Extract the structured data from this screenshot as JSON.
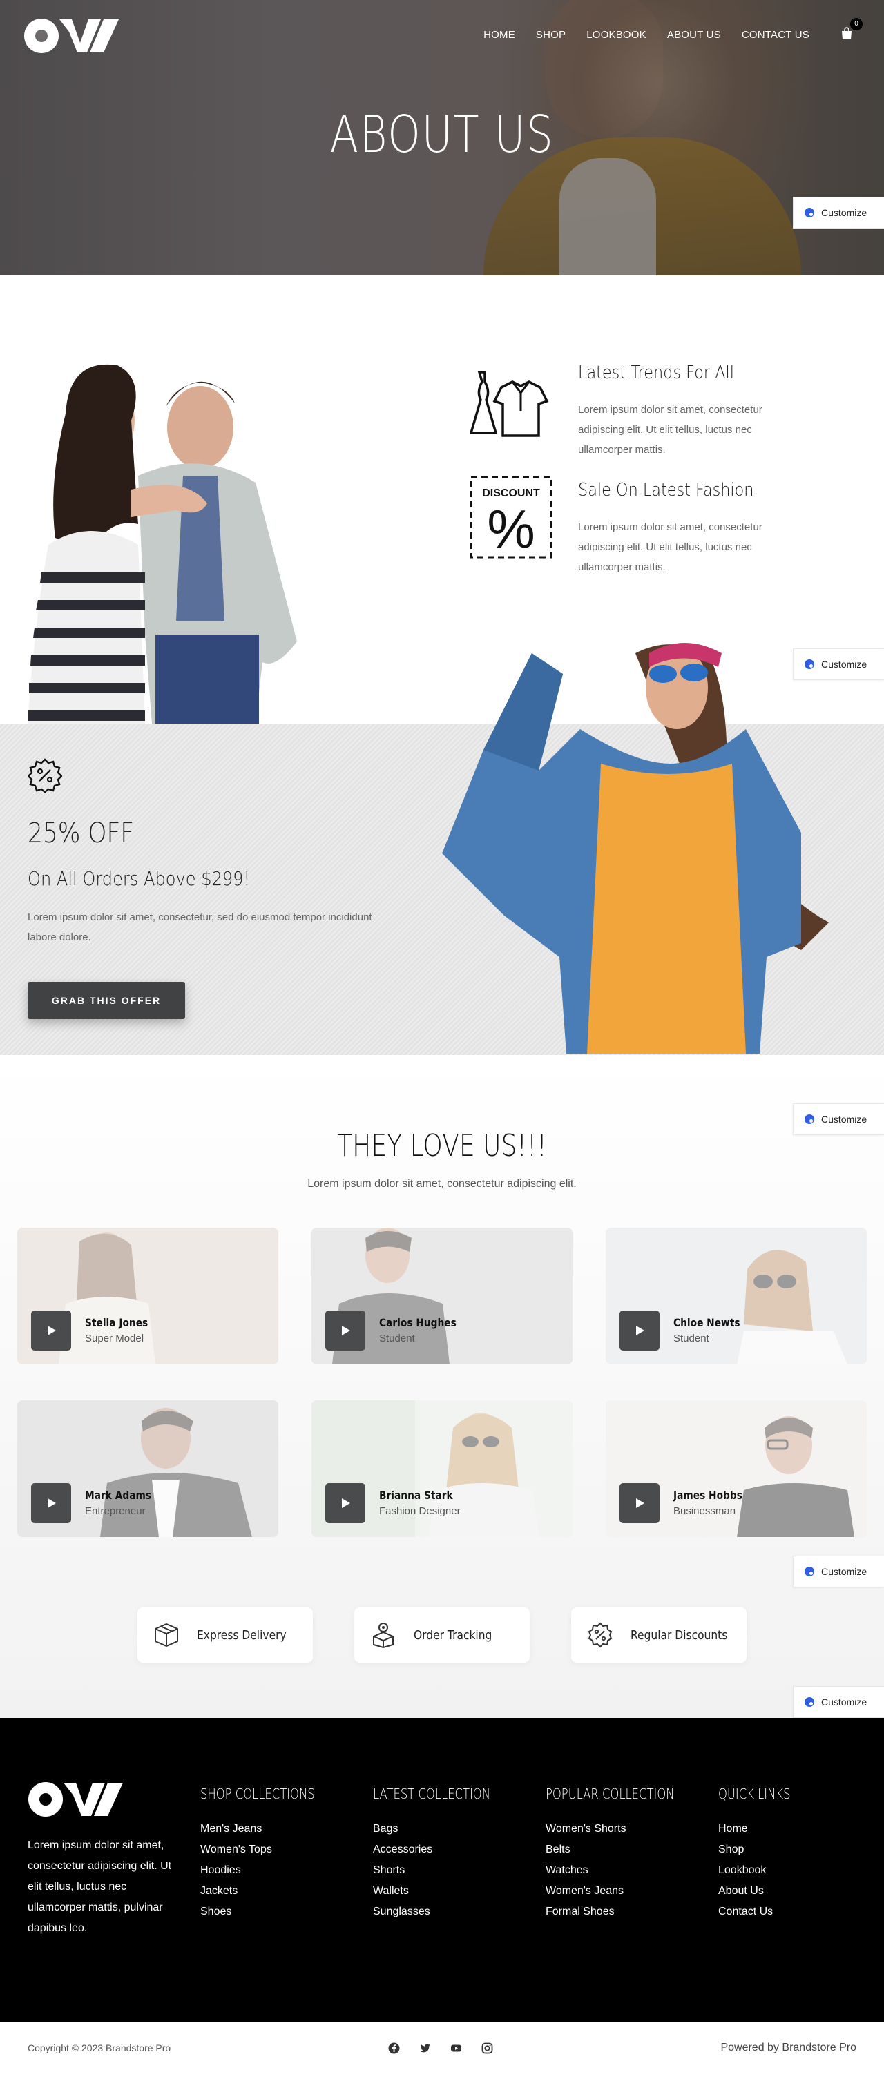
{
  "nav": {
    "items": [
      {
        "label": "HOME"
      },
      {
        "label": "SHOP"
      },
      {
        "label": "LOOKBOOK"
      },
      {
        "label": "ABOUT US"
      },
      {
        "label": "CONTACT US"
      }
    ],
    "cart_count": "0"
  },
  "hero": {
    "title": "ABOUT US"
  },
  "customize": {
    "label": "Customize"
  },
  "features": [
    {
      "title": "Latest Trends For All",
      "text": "Lorem ipsum dolor sit amet, consectetur adipiscing elit. Ut elit tellus, luctus nec ullamcorper mattis.",
      "icon": "clothes-icon"
    },
    {
      "title": "Sale On Latest Fashion",
      "text": "Lorem ipsum dolor sit amet, consectetur adipiscing elit. Ut elit tellus, luctus nec ullamcorper mattis.",
      "icon": "discount-icon",
      "icon_text": "DISCOUNT",
      "icon_symbol": "%"
    }
  ],
  "offer": {
    "headline": "25% OFF",
    "subheadline": "On All Orders Above $299!",
    "text": "Lorem ipsum dolor sit amet, consectetur, sed do eiusmod tempor incididunt labore dolore.",
    "button": "GRAB THIS OFFER"
  },
  "testimonials": {
    "title": "THEY LOVE US!!!",
    "subtitle": "Lorem ipsum dolor sit amet, consectetur adipiscing elit.",
    "people": [
      {
        "name": "Stella Jones",
        "role": "Super Model"
      },
      {
        "name": "Carlos Hughes",
        "role": "Student"
      },
      {
        "name": "Chloe Newts",
        "role": "Student"
      },
      {
        "name": "Mark Adams",
        "role": "Entrepreneur"
      },
      {
        "name": "Brianna Stark",
        "role": "Fashion Designer"
      },
      {
        "name": "James Hobbs",
        "role": "Businessman"
      }
    ]
  },
  "services": [
    {
      "label": "Express Delivery",
      "icon": "box-icon"
    },
    {
      "label": "Order Tracking",
      "icon": "tracking-icon"
    },
    {
      "label": "Regular Discounts",
      "icon": "discount-badge-icon"
    }
  ],
  "footer": {
    "about": "Lorem ipsum dolor sit amet, consectetur adipiscing elit. Ut elit tellus, luctus nec ullamcorper mattis, pulvinar dapibus leo.",
    "columns": [
      {
        "title": "SHOP COLLECTIONS",
        "links": [
          "Men's Jeans",
          "Women's Tops",
          "Hoodies",
          "Jackets",
          "Shoes"
        ]
      },
      {
        "title": "LATEST COLLECTION",
        "links": [
          "Bags",
          "Accessories",
          "Shorts",
          "Wallets",
          "Sunglasses"
        ]
      },
      {
        "title": "POPULAR COLLECTION",
        "links": [
          "Women's Shorts",
          "Belts",
          "Watches",
          "Women's Jeans",
          "Formal Shoes"
        ]
      },
      {
        "title": "QUICK LINKS",
        "links": [
          "Home",
          "Shop",
          "Lookbook",
          "About Us",
          "Contact Us"
        ]
      }
    ],
    "copyright": "Copyright © 2023 Brandstore Pro",
    "powered": "Powered by Brandstore Pro",
    "socials": [
      "facebook-icon",
      "twitter-icon",
      "youtube-icon",
      "instagram-icon"
    ]
  },
  "colors": {
    "button_dark": "#414243",
    "footer_bg": "#000000",
    "customize_accent": "#2f5fe0"
  }
}
